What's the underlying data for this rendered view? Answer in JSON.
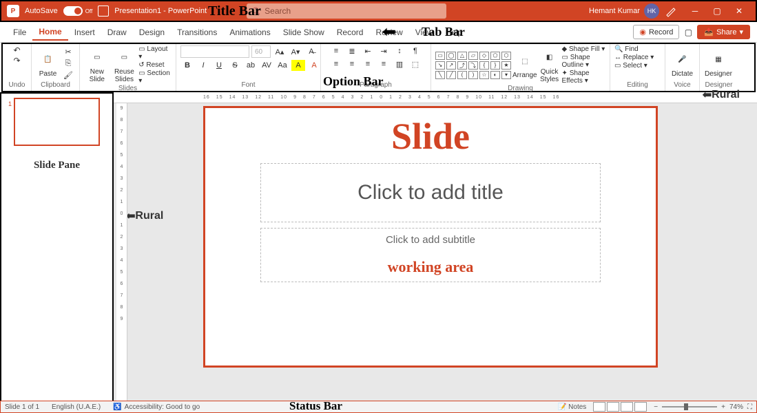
{
  "titlebar": {
    "autosave": "AutoSave",
    "toggle_state": "Off",
    "doc": "Presentation1 - PowerPoint",
    "label": "Title Bar",
    "search_ph": "Search",
    "user": "Hemant Kumar",
    "initials": "HK"
  },
  "tabs": [
    "File",
    "Home",
    "Insert",
    "Draw",
    "Design",
    "Transitions",
    "Animations",
    "Slide Show",
    "Record",
    "Review",
    "View",
    "Help"
  ],
  "tabbar": {
    "label": "Tab Bar",
    "record": "Record",
    "share": "Share"
  },
  "ribbon": {
    "undo": "Undo",
    "paste": "Paste",
    "clipboard": "Clipboard",
    "newslide": "New Slide",
    "reuse": "Reuse Slides",
    "layout": "Layout",
    "reset": "Reset",
    "section": "Section",
    "slides": "Slides",
    "fontsize": "60",
    "font": "Font",
    "paragraph": "Paragraph",
    "arrange": "Arrange",
    "quick": "Quick Styles",
    "fill": "Shape Fill",
    "outline": "Shape Outline",
    "effects": "Shape Effects",
    "drawing": "Drawing",
    "find": "Find",
    "replace": "Replace",
    "select": "Select",
    "editing": "Editing",
    "dictate": "Dictate",
    "voice": "Voice",
    "designer": "Designer",
    "designer_g": "Designer",
    "option_label": "Option Bar"
  },
  "pane": {
    "label": "Slide Pane",
    "num": "1"
  },
  "rural": "Rural",
  "ruler_h": [
    "16",
    "15",
    "14",
    "13",
    "12",
    "11",
    "10",
    "9",
    "8",
    "7",
    "6",
    "5",
    "4",
    "3",
    "2",
    "1",
    "0",
    "1",
    "2",
    "3",
    "4",
    "5",
    "6",
    "7",
    "8",
    "9",
    "10",
    "11",
    "12",
    "13",
    "14",
    "15",
    "16"
  ],
  "ruler_v": [
    "9",
    "8",
    "7",
    "6",
    "5",
    "4",
    "3",
    "2",
    "1",
    "0",
    "1",
    "2",
    "3",
    "4",
    "5",
    "6",
    "7",
    "8",
    "9"
  ],
  "slide": {
    "label": "Slide",
    "title_ph": "Click to add title",
    "sub_ph": "Click to add subtitle",
    "work": "working area"
  },
  "status": {
    "slide": "Slide 1 of 1",
    "lang": "English (U.A.E.)",
    "access": "Accessibility: Good to go",
    "label": "Status Bar",
    "notes": "Notes",
    "zoom": "74%"
  }
}
